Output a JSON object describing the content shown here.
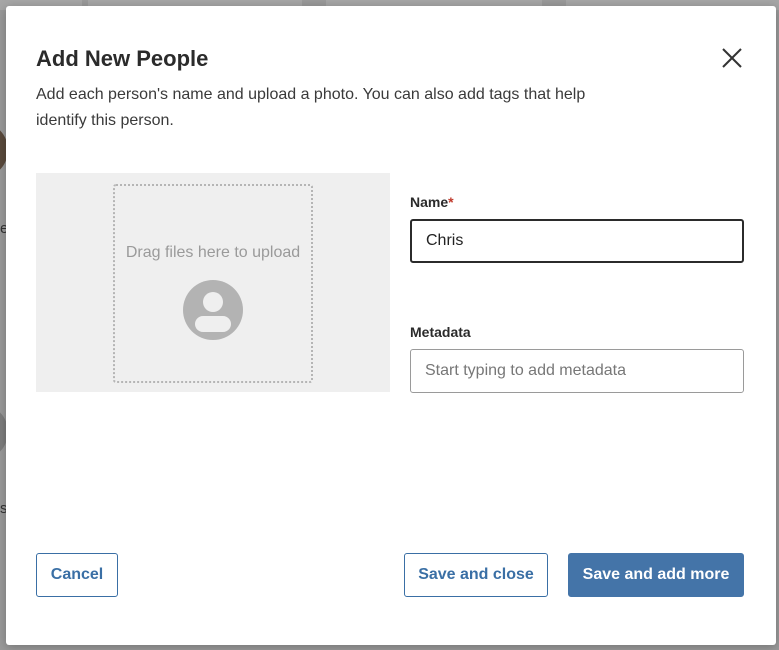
{
  "background": {
    "partial_letters": [
      "e",
      "s"
    ]
  },
  "dialog": {
    "title": "Add New People",
    "description": "Add each person's name and upload a photo. You can also add tags that help identify this person.",
    "close_icon": "close-icon"
  },
  "upload": {
    "prompt": "Drag files here to upload",
    "icon": "person-placeholder-icon"
  },
  "form": {
    "name_label": "Name",
    "required_marker": "*",
    "name_value": "Chris",
    "metadata_label": "Metadata",
    "metadata_placeholder": "Start typing to add metadata"
  },
  "buttons": {
    "cancel": "Cancel",
    "save_close": "Save and close",
    "save_more": "Save and add more"
  },
  "colors": {
    "primary": "#4474a8",
    "required": "#c0392b",
    "upload_bg": "#efefef"
  }
}
